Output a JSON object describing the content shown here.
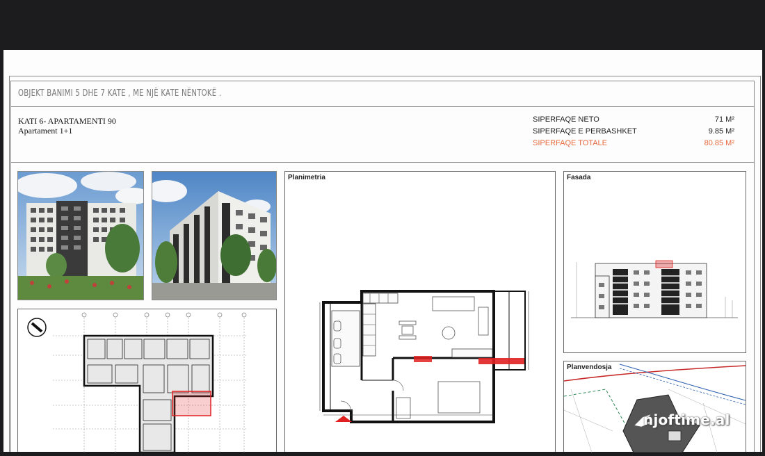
{
  "document": {
    "title": "OBJEKT BANIMI 5 DHE 7 KATE , ME NJË KATE NËNTOKË .",
    "apartment_title": "KATI 6- APARTAMENTI  90",
    "apartment_type": "Apartament 1+1"
  },
  "areas": [
    {
      "label": "SIPERFAQE NETO",
      "value": "71 M²"
    },
    {
      "label": "SIPERFAQE E PERBASHKET",
      "value": "9.85 M²"
    },
    {
      "label": "SIPERFAQE TOTALE",
      "value": "80.85 M²"
    }
  ],
  "panels": {
    "plan": "Planimetria",
    "facade": "Fasada",
    "site": "Planvendosja"
  },
  "watermark": "njoftime.al",
  "colors": {
    "total_accent": "#e8693f",
    "highlight": "#e02020"
  }
}
